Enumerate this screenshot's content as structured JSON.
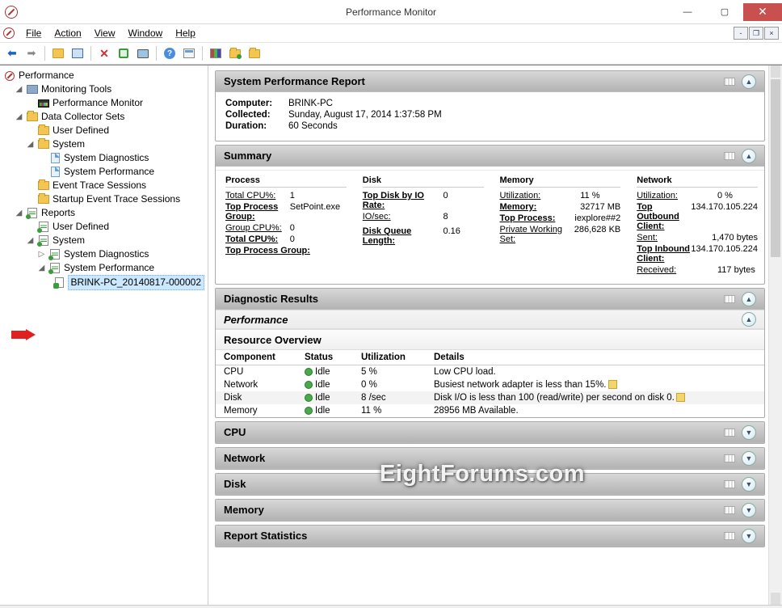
{
  "window": {
    "title": "Performance Monitor"
  },
  "menu": {
    "file": "File",
    "action": "Action",
    "view": "View",
    "window": "Window",
    "help": "Help"
  },
  "tree": {
    "root": "Performance",
    "monitoring_tools": "Monitoring Tools",
    "perfmon": "Performance Monitor",
    "dcs": "Data Collector Sets",
    "user_defined": "User Defined",
    "system": "System",
    "sysdiag": "System Diagnostics",
    "sysperf": "System Performance",
    "ets": "Event Trace Sessions",
    "sets": "Startup Event Trace Sessions",
    "reports": "Reports",
    "r_user_defined": "User Defined",
    "r_system": "System",
    "r_sysdiag": "System Diagnostics",
    "r_sysperf": "System Performance",
    "r_file": "BRINK-PC_20140817-000002"
  },
  "report": {
    "title": "System Performance Report",
    "computer_lbl": "Computer:",
    "computer": "BRINK-PC",
    "collected_lbl": "Collected:",
    "collected": "Sunday, August 17, 2014 1:37:58 PM",
    "duration_lbl": "Duration:",
    "duration": "60 Seconds"
  },
  "summary": {
    "title": "Summary",
    "process": {
      "head": "Process",
      "total_cpu_lbl": "Total CPU%:",
      "total_cpu": "1",
      "top_group_lbl": "Top Process Group:",
      "top_group": "SetPoint.exe",
      "group_cpu_lbl": "Group CPU%:",
      "group_cpu": "0",
      "total_cpu2_lbl": "Total CPU%:",
      "total_cpu2": "0",
      "top_group2_lbl": "Top Process Group:"
    },
    "disk": {
      "head": "Disk",
      "io_rate_lbl": "Top Disk by IO Rate:",
      "io_rate": "0",
      "io_sec_lbl": "IO/sec:",
      "io_sec": "8",
      "queue_lbl": "Disk Queue Length:",
      "queue": "0.16"
    },
    "memory": {
      "head": "Memory",
      "util_lbl": "Utilization:",
      "util": "11 %",
      "mem_lbl": "Memory:",
      "mem": "32717 MB",
      "top_proc_lbl": "Top Process:",
      "top_proc": "iexplore##2",
      "pws_lbl": "Private Working Set:",
      "pws": "286,628 KB"
    },
    "network": {
      "head": "Network",
      "util_lbl": "Utilization:",
      "util": "0 %",
      "out_lbl": "Top Outbound Client:",
      "out": "134.170.105.224",
      "sent_lbl": "Sent:",
      "sent": "1,470 bytes",
      "in_lbl": "Top Inbound Client:",
      "in": "134.170.105.224",
      "recv_lbl": "Received:",
      "recv": "117 bytes"
    }
  },
  "diag": {
    "title": "Diagnostic Results"
  },
  "perf": {
    "title": "Performance"
  },
  "resource": {
    "title": "Resource Overview",
    "h_comp": "Component",
    "h_status": "Status",
    "h_util": "Utilization",
    "h_details": "Details",
    "rows": [
      {
        "c": "CPU",
        "s": "Idle",
        "u": "5 %",
        "d": "Low CPU load."
      },
      {
        "c": "Network",
        "s": "Idle",
        "u": "0 %",
        "d": "Busiest network adapter is less than 15%."
      },
      {
        "c": "Disk",
        "s": "Idle",
        "u": "8 /sec",
        "d": "Disk I/O is less than 100 (read/write) per second on disk 0."
      },
      {
        "c": "Memory",
        "s": "Idle",
        "u": "11 %",
        "d": "28956 MB Available."
      }
    ]
  },
  "sections": {
    "cpu": "CPU",
    "net": "Network",
    "disk": "Disk",
    "mem": "Memory",
    "stats": "Report Statistics"
  },
  "watermark": "EightForums.com"
}
